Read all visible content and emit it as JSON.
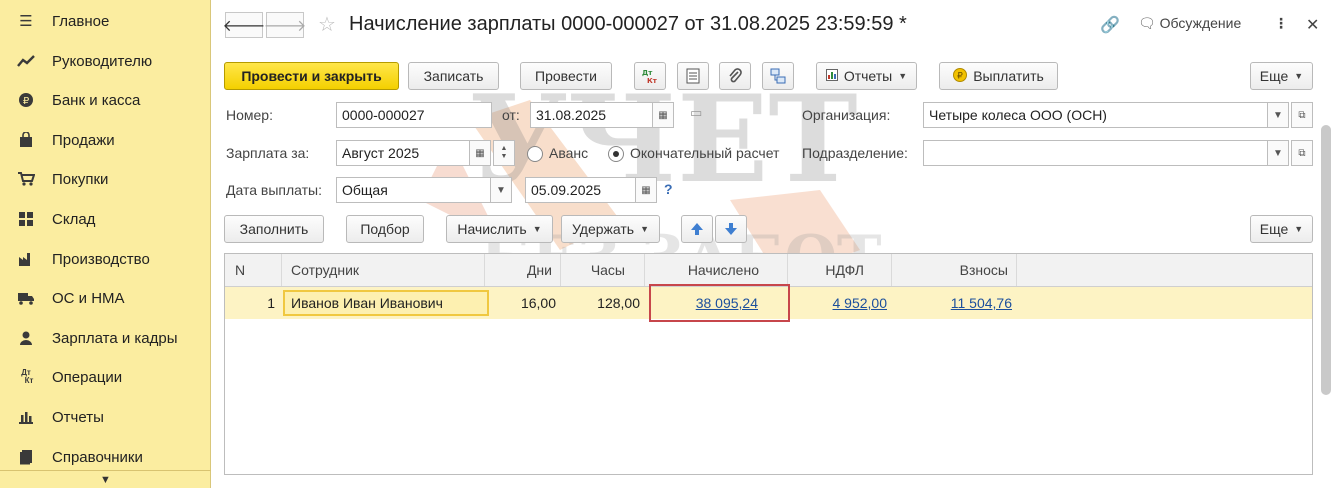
{
  "sidebar": {
    "items": [
      {
        "label": "Главное",
        "icon": "menu-icon"
      },
      {
        "label": "Руководителю",
        "icon": "trend-icon"
      },
      {
        "label": "Банк и касса",
        "icon": "coin-icon"
      },
      {
        "label": "Продажи",
        "icon": "bag-icon"
      },
      {
        "label": "Покупки",
        "icon": "cart-icon"
      },
      {
        "label": "Склад",
        "icon": "warehouse-icon"
      },
      {
        "label": "Производство",
        "icon": "factory-icon"
      },
      {
        "label": "ОС и НМА",
        "icon": "truck-icon"
      },
      {
        "label": "Зарплата и кадры",
        "icon": "person-icon"
      },
      {
        "label": "Операции",
        "icon": "dt-kt-icon"
      },
      {
        "label": "Отчеты",
        "icon": "bar-chart-icon"
      },
      {
        "label": "Справочники",
        "icon": "book-icon"
      }
    ]
  },
  "header": {
    "title": "Начисление зарплаты 0000-000027 от 31.08.2025 23:59:59 *",
    "discussion": "Обсуждение"
  },
  "toolbar": {
    "post_and_close": "Провести и закрыть",
    "save": "Записать",
    "post": "Провести",
    "reports": "Отчеты",
    "pay": "Выплатить",
    "more": "Еще",
    "dt_kt_top": "Дт",
    "dt_kt_bottom": "Кт"
  },
  "form": {
    "number_label": "Номер:",
    "number_value": "0000-000027",
    "date_label": "от:",
    "date_value": "31.08.2025",
    "org_label": "Организация:",
    "org_value": "Четыре колеса ООО (ОСН)",
    "salary_for_label": "Зарплата за:",
    "salary_for_value": "Август 2025",
    "advance_label": "Аванс",
    "final_label": "Окончательный расчет",
    "dept_label": "Подразделение:",
    "dept_value": "",
    "pay_date_label": "Дата выплаты:",
    "pay_date_type": "Общая",
    "pay_date_value": "05.09.2025",
    "help": "?"
  },
  "table_toolbar": {
    "fill": "Заполнить",
    "pick": "Подбор",
    "accrue": "Начислить",
    "withhold": "Удержать",
    "more": "Еще"
  },
  "table": {
    "headers": [
      "N",
      "Сотрудник",
      "Дни",
      "Часы",
      "Начислено",
      "НДФЛ",
      "Взносы"
    ],
    "rows": [
      {
        "n": "1",
        "employee": "Иванов Иван Иванович",
        "days": "16,00",
        "hours": "128,00",
        "accrued": "38 095,24",
        "ndfl": "4 952,00",
        "contributions": "11 504,76"
      }
    ]
  },
  "watermark": {
    "line1": "УЧЕТ",
    "line2": "БЕЗ ЗАБОТ"
  }
}
